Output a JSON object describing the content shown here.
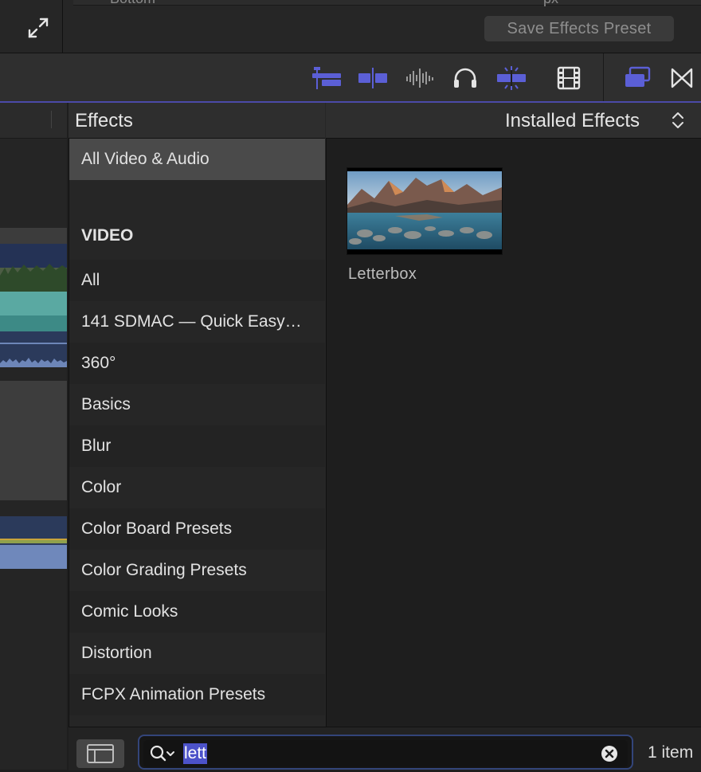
{
  "inspector": {
    "partial_field_text": "Bottom",
    "partial_unit": "px",
    "save_preset_label": "Save Effects Preset"
  },
  "toolbar": {
    "icons": [
      "clip-appearance-icon",
      "split-icon",
      "audio-waveform-icon",
      "headphones-icon",
      "skimming-icon",
      "filmstrip-icon",
      "overlay-icon",
      "transitions-icon"
    ],
    "accent_color": "#5b5fd6"
  },
  "sidebar": {
    "title": "Effects",
    "items": [
      {
        "label": "All Video & Audio",
        "selected": true
      },
      {
        "label": ""
      },
      {
        "label": "VIDEO",
        "header": true
      },
      {
        "label": "All"
      },
      {
        "label": "141 SDMAC — Quick Easy…"
      },
      {
        "label": "360°"
      },
      {
        "label": "Basics"
      },
      {
        "label": "Blur"
      },
      {
        "label": "Color"
      },
      {
        "label": "Color Board Presets"
      },
      {
        "label": "Color Grading Presets"
      },
      {
        "label": "Comic Looks"
      },
      {
        "label": "Distortion"
      },
      {
        "label": "FCPX Animation Presets"
      }
    ]
  },
  "results": {
    "filter_label": "Installed Effects",
    "items": [
      {
        "label": "Letterbox"
      }
    ],
    "count_label": "1 item"
  },
  "search": {
    "value": "lett"
  }
}
